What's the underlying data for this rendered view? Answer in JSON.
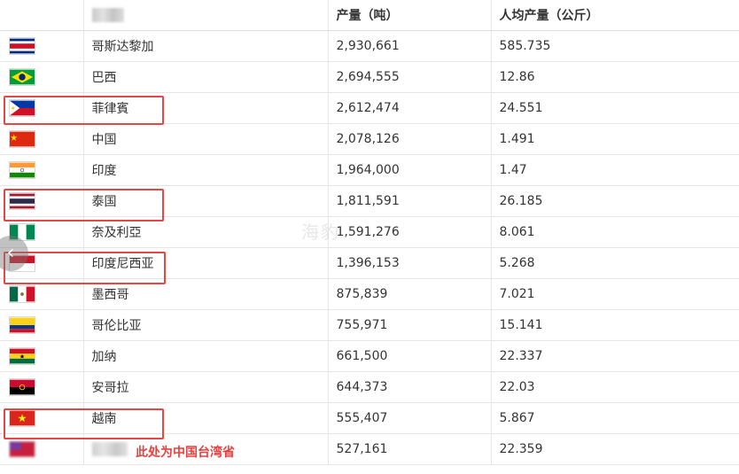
{
  "table": {
    "headers": [
      "",
      "",
      "产量（吨）",
      "人均产量（公斤）"
    ],
    "rows": [
      {
        "flag": "costa-rica",
        "country": "哥斯达黎加",
        "production": "2,930,661",
        "per_capita": "585.735"
      },
      {
        "flag": "brazil",
        "country": "巴西",
        "production": "2,694,555",
        "per_capita": "12.86"
      },
      {
        "flag": "philippines",
        "country": "菲律賓",
        "production": "2,612,474",
        "per_capita": "24.551"
      },
      {
        "flag": "china",
        "country": "中国",
        "production": "2,078,126",
        "per_capita": "1.491"
      },
      {
        "flag": "india",
        "country": "印度",
        "production": "1,964,000",
        "per_capita": "1.47"
      },
      {
        "flag": "thailand",
        "country": "泰国",
        "production": "1,811,591",
        "per_capita": "26.185"
      },
      {
        "flag": "nigeria",
        "country": "奈及利亞",
        "production": "1,591,276",
        "per_capita": "8.061"
      },
      {
        "flag": "indonesia",
        "country": "印度尼西亚",
        "production": "1,396,153",
        "per_capita": "5.268"
      },
      {
        "flag": "mexico",
        "country": "墨西哥",
        "production": "875,839",
        "per_capita": "7.021"
      },
      {
        "flag": "colombia",
        "country": "哥伦比亚",
        "production": "755,971",
        "per_capita": "15.141"
      },
      {
        "flag": "ghana",
        "country": "加纳",
        "production": "661,500",
        "per_capita": "22.337"
      },
      {
        "flag": "angola",
        "country": "安哥拉",
        "production": "644,373",
        "per_capita": "22.03"
      },
      {
        "flag": "vietnam",
        "country": "越南",
        "production": "555,407",
        "per_capita": "5.867"
      },
      {
        "flag": "redacted",
        "country": "",
        "production": "527,161",
        "per_capita": "22.359"
      }
    ]
  },
  "annotation": {
    "note": "此处为中国台湾省",
    "highlight_color": "#e84545"
  },
  "watermark": {
    "text": "海豹"
  },
  "scroll_button": {
    "icon": "chevron-left-icon"
  }
}
